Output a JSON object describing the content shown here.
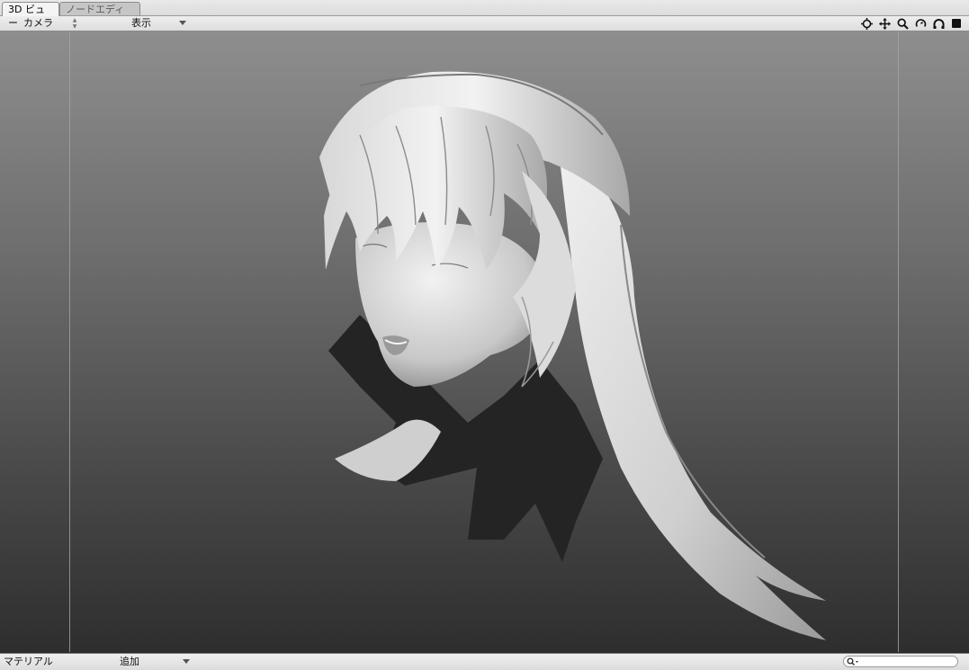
{
  "tabs": [
    {
      "label": "3D ビュー",
      "active": true
    },
    {
      "label": "ノードエディタ",
      "active": false
    }
  ],
  "toolbar": {
    "camera_label": "カメラ",
    "display_label": "表示",
    "tools": [
      "target-icon",
      "move-icon",
      "zoom-icon",
      "rotate-icon",
      "orbit-icon",
      "stop-icon"
    ]
  },
  "viewport": {
    "content": "3D hair and head model",
    "background_top": "#8e8e8e",
    "background_bottom": "#2e2e2e"
  },
  "bottom": {
    "material_label": "マテリアル",
    "add_label": "追加",
    "search_value": ""
  }
}
